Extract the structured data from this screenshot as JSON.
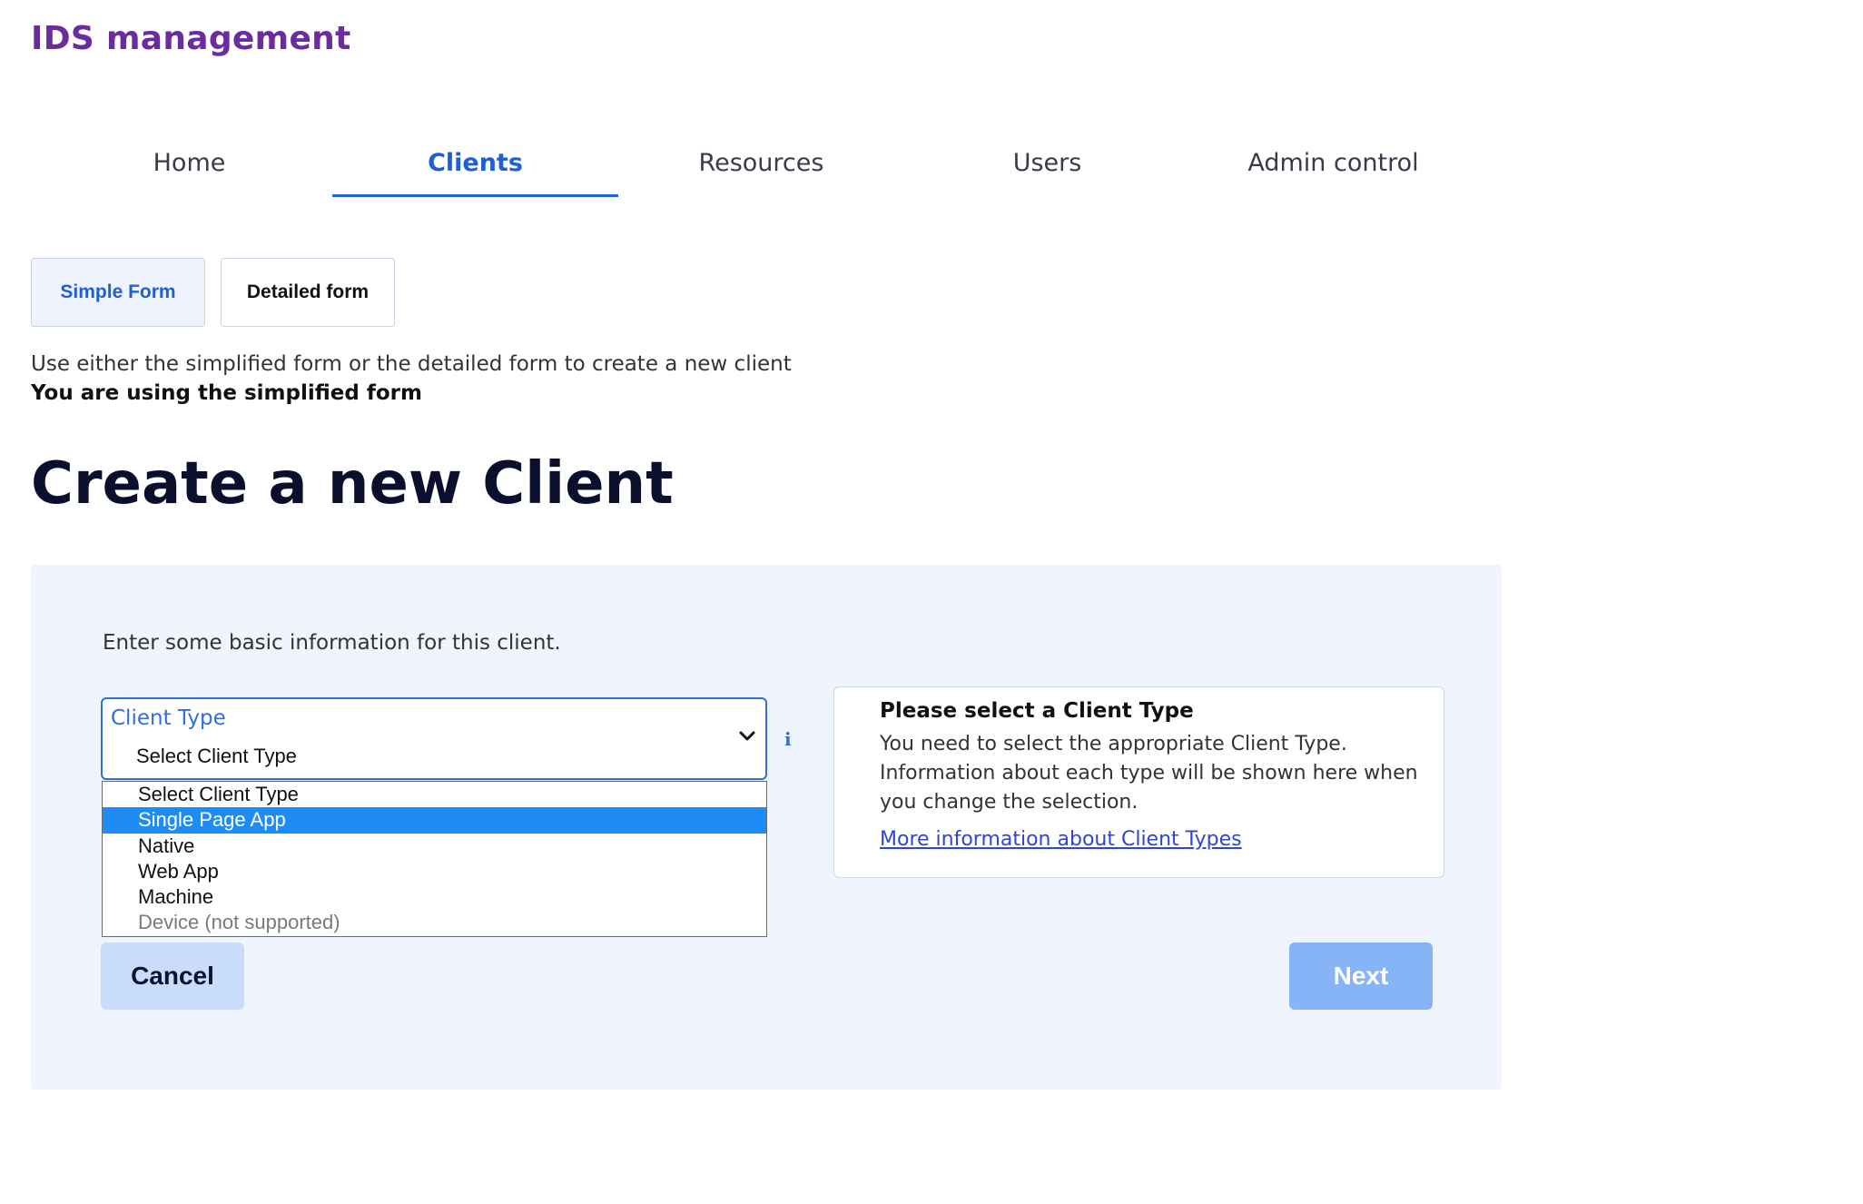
{
  "app": {
    "title": "IDS management"
  },
  "nav": {
    "tabs": [
      {
        "label": "Home",
        "active": false
      },
      {
        "label": "Clients",
        "active": true
      },
      {
        "label": "Resources",
        "active": false
      },
      {
        "label": "Users",
        "active": false
      },
      {
        "label": "Admin control",
        "active": false
      }
    ]
  },
  "form_toggle": {
    "simple_label": "Simple Form",
    "detailed_label": "Detailed form",
    "active": "simple"
  },
  "intro": {
    "text": "Use either the simplified form or the detailed form to create a new client",
    "status": "You are using the simplified form"
  },
  "page": {
    "title": "Create a new Client"
  },
  "panel": {
    "intro": "Enter some basic information for this client.",
    "client_type": {
      "label": "Client Type",
      "value": "Select Client Type",
      "options": [
        {
          "label": "Select Client Type",
          "state": "normal"
        },
        {
          "label": "Single Page App",
          "state": "highlighted"
        },
        {
          "label": "Native",
          "state": "normal"
        },
        {
          "label": "Web App",
          "state": "normal"
        },
        {
          "label": "Machine",
          "state": "normal"
        },
        {
          "label": "Device (not supported)",
          "state": "disabled"
        }
      ]
    },
    "info_icon": "info-icon",
    "info_card": {
      "title": "Please select a Client Type",
      "body": "You need to select the appropriate Client Type. Information about each type will be shown here when you change the selection.",
      "link": "More information about Client Types"
    },
    "buttons": {
      "cancel": "Cancel",
      "next": "Next"
    }
  },
  "colors": {
    "brand": "#6b2d9e",
    "accent": "#1f5fd6",
    "panel_bg": "#f0f5fd",
    "highlight": "#1e8cf5",
    "next_disabled": "#86b4f7",
    "cancel_bg": "#c9dcfb"
  }
}
